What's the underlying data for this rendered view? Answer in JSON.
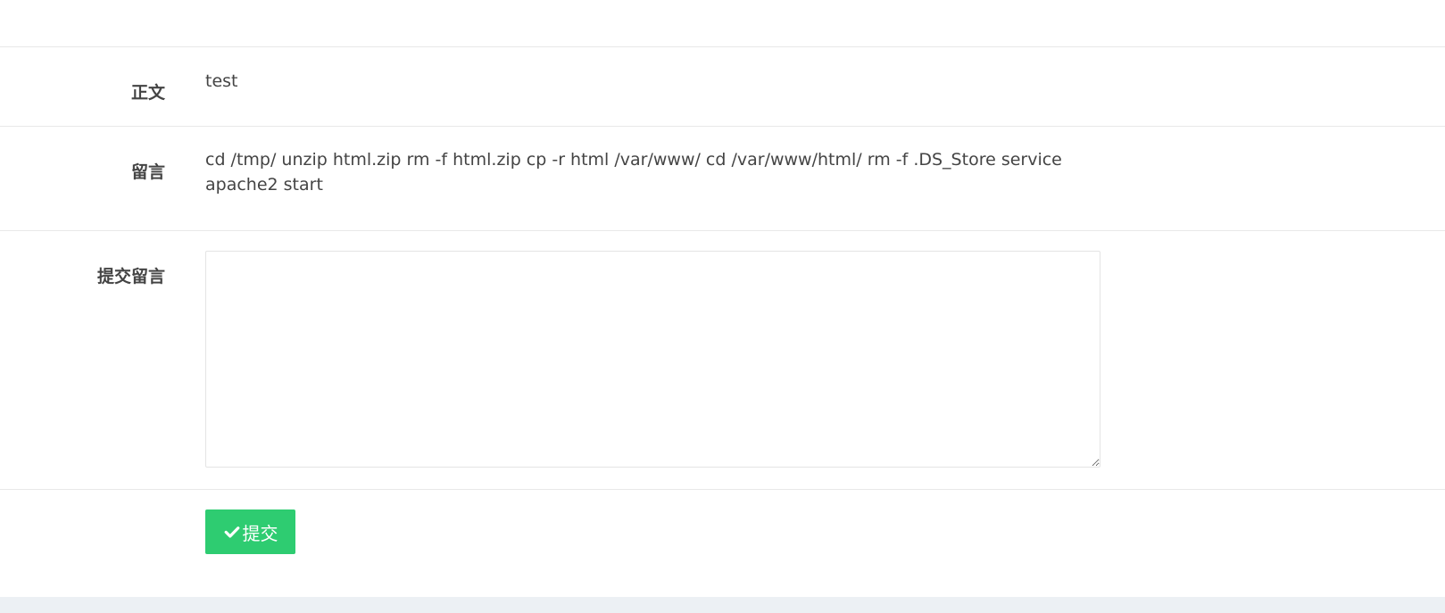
{
  "form": {
    "body_row": {
      "label": "正文",
      "value": "test"
    },
    "message_row": {
      "label": "留言",
      "value": "cd /tmp/ unzip html.zip rm -f html.zip cp -r html /var/www/ cd /var/www/html/ rm -f .DS_Store service apache2 start"
    },
    "comment_row": {
      "label": "提交留言",
      "input_value": ""
    },
    "actions": {
      "submit_label": "提交",
      "submit_icon": "check-icon"
    }
  },
  "colors": {
    "submit_button": "#2ecc71",
    "text": "#444444",
    "divider": "#e8e8e8",
    "footer": "#ecf0f4"
  }
}
